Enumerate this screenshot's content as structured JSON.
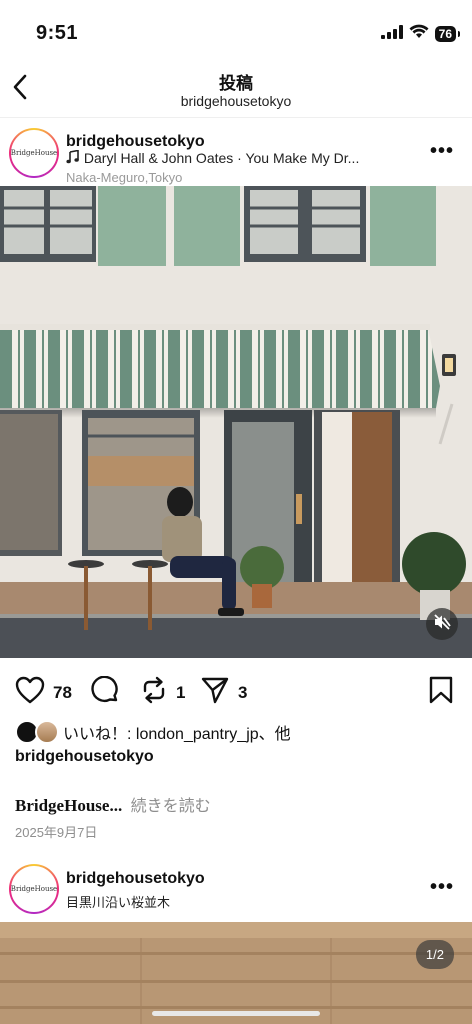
{
  "status_bar": {
    "time": "9:51",
    "battery": "76"
  },
  "header": {
    "title": "投稿",
    "subtitle": "bridgehousetokyo"
  },
  "post": {
    "avatar_label": "BridgeHouse",
    "username": "bridgehousetokyo",
    "music": "Daryl Hall & John Oates · You Make My Dr...",
    "location": "Naka-Meguro,Tokyo",
    "more": "•••",
    "likes_count": "78",
    "reposts_count": "1",
    "shares_count": "3",
    "liked_by": "いいね！: london_pantry_jp、他",
    "owner": "bridgehousetokyo",
    "caption": "BridgeHouse...",
    "caption_more": "続きを読む",
    "date": "2025年9月7日"
  },
  "post2": {
    "avatar_label": "BridgeHouse",
    "username": "bridgehousetokyo",
    "location": "目黒川沿い桜並木",
    "more": "•••",
    "page_indicator": "1/2"
  },
  "icons": {
    "back": "chevron-left-icon",
    "music": "music-note-icon",
    "heart": "heart-icon",
    "comment": "comment-icon",
    "repost": "repost-icon",
    "share": "send-icon",
    "bookmark": "bookmark-icon",
    "mute": "speaker-muted-icon"
  },
  "colors": {
    "awning_green": "#6b8f7e",
    "shutter_green": "#8fb29c",
    "wall": "#eae6e0"
  }
}
